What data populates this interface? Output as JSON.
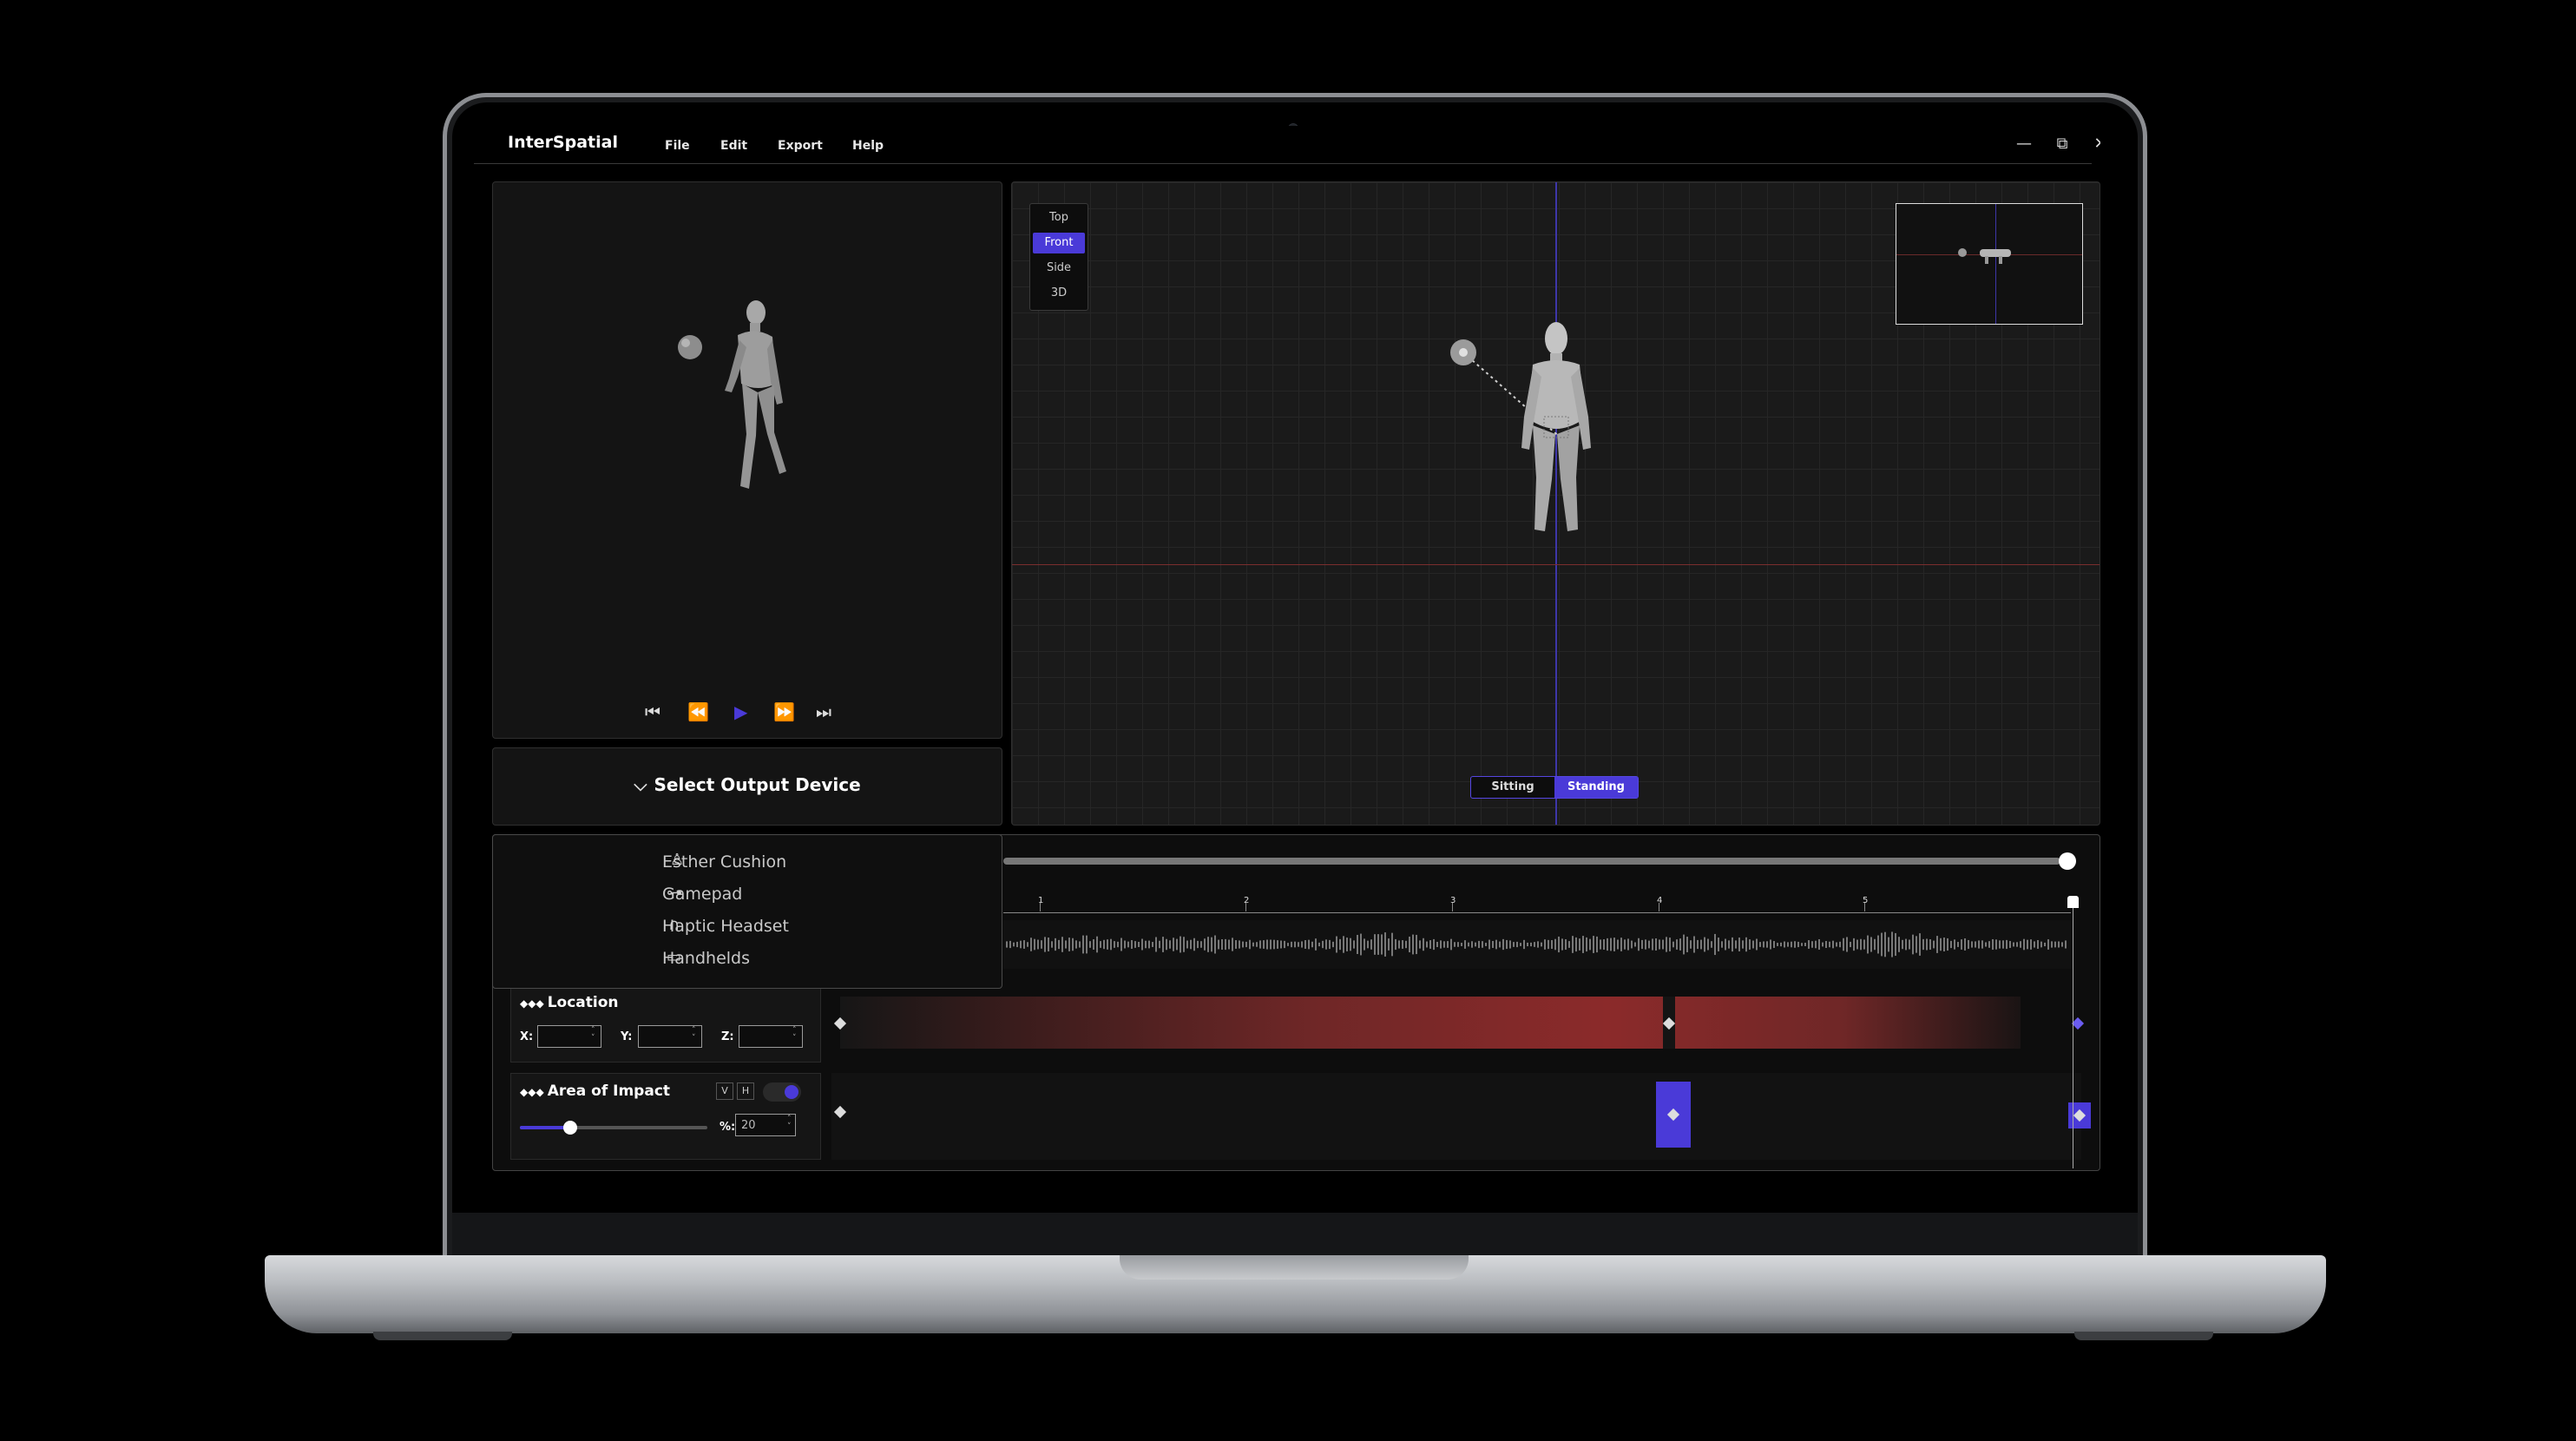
{
  "app": {
    "title": "InterSpatial",
    "menu": [
      "File",
      "Edit",
      "Export",
      "Help"
    ]
  },
  "window_controls": {
    "minimize": "—",
    "restore": "⧉",
    "close": "✕"
  },
  "preview": {
    "transport": {
      "skip_back": "⏮",
      "rewind": "⏪",
      "play": "▶",
      "fast_forward": "⏩",
      "skip_forward": "⏭"
    }
  },
  "output_device": {
    "label": "Select Output Device",
    "chevron": "⌵",
    "options": [
      {
        "label": "Esther Cushion",
        "icon": "cushion-icon"
      },
      {
        "label": "Gamepad",
        "icon": "gamepad-icon"
      },
      {
        "label": "Haptic Headset",
        "icon": "headset-icon"
      },
      {
        "label": "Handhelds",
        "icon": "handheld-icon"
      }
    ]
  },
  "viewport": {
    "views": [
      "Top",
      "Front",
      "Side",
      "3D"
    ],
    "active_view": "Front",
    "pose": {
      "options": [
        "Sitting",
        "Standing"
      ],
      "active": "Standing"
    }
  },
  "timeline": {
    "ruler": [
      "1",
      "2",
      "3",
      "4",
      "5"
    ],
    "tracks": {
      "location": {
        "title": "Location",
        "keyframe_glyph": "◆◆◆",
        "x_label": "X:",
        "y_label": "Y:",
        "z_label": "Z:",
        "x_value": "",
        "y_value": "",
        "z_value": ""
      },
      "impact": {
        "title": "Area of Impact",
        "keyframe_glyph": "◆◆◆",
        "v_label": "V",
        "h_label": "H",
        "toggle_on": true,
        "percent_label": "%:",
        "percent_value": "20",
        "slider_fraction": 0.27
      }
    }
  },
  "colors": {
    "accent": "#4a3ad8",
    "heat": "#8b2a2a",
    "background": "#141414"
  }
}
